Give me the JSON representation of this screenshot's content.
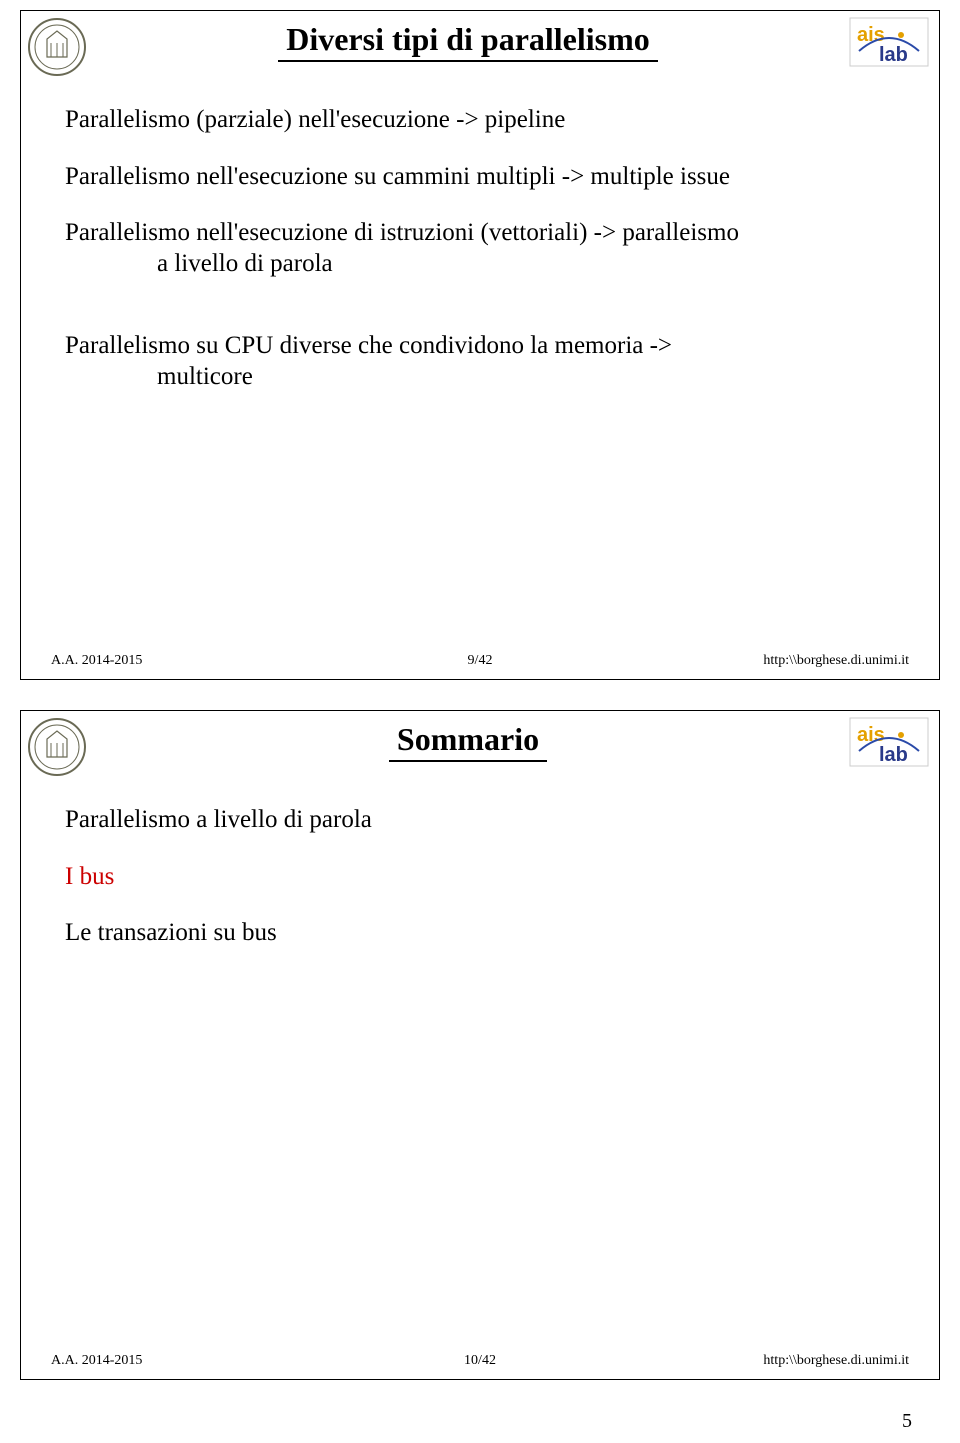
{
  "slide1": {
    "title": "Diversi tipi di parallelismo",
    "p1": "Parallelismo (parziale) nell'esecuzione -> pipeline",
    "p2": "Parallelismo nell'esecuzione su cammini multipli -> multiple issue",
    "p3a": "Parallelismo nell'esecuzione di istruzioni (vettoriali) -> paralleismo",
    "p3b": "a livello di parola",
    "p4a": "Parallelismo su CPU diverse che condividono la memoria ->",
    "p4b": "multicore",
    "footer_left": "A.A. 2014-2015",
    "footer_mid": "9/42",
    "footer_right": "http:\\\\borghese.di.unimi.it"
  },
  "slide2": {
    "title": "Sommario",
    "p1": "Parallelismo a livello di parola",
    "p2": "I bus",
    "p3": "Le transazioni  su bus",
    "footer_left": "A.A. 2014-2015",
    "footer_mid": "10/42",
    "footer_right": "http:\\\\borghese.di.unimi.it"
  },
  "page_number": "5"
}
